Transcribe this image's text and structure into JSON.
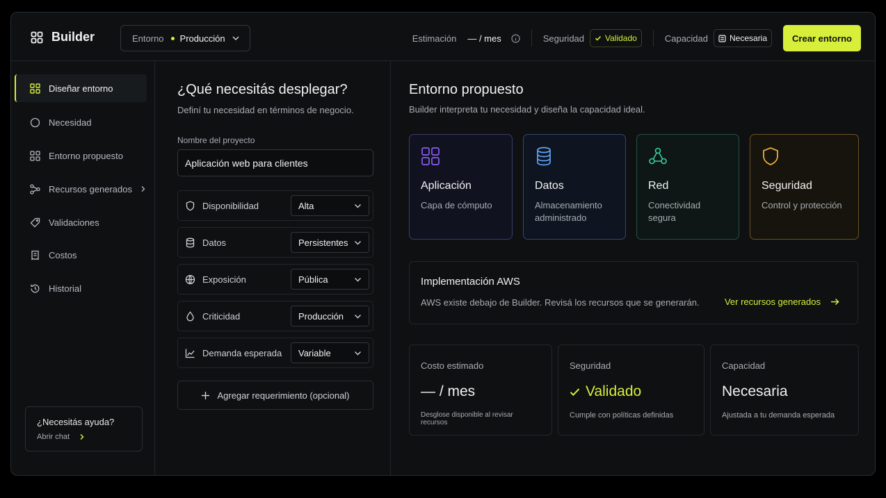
{
  "app": {
    "title": "Builder"
  },
  "header": {
    "env_label": "Entorno",
    "env_value": "Producción",
    "estimate_label": "Estimación",
    "estimate_value": "— / mes",
    "security_label": "Seguridad",
    "security_value": "Validado",
    "capacity_label": "Capacidad",
    "capacity_value": "Necesaria",
    "create_button": "Crear entorno"
  },
  "sidebar": {
    "items": [
      {
        "label": "Diseñar entorno",
        "icon": "grid-icon",
        "active": true
      },
      {
        "label": "Necesidad",
        "icon": "circle-icon"
      },
      {
        "label": "Entorno propuesto",
        "icon": "grid-icon"
      },
      {
        "label": "Recursos generados",
        "icon": "nodes-icon"
      },
      {
        "label": "Validaciones",
        "icon": "tag-icon"
      },
      {
        "label": "Costos",
        "icon": "receipt-icon"
      },
      {
        "label": "Historial",
        "icon": "history-icon"
      }
    ],
    "help_title": "¿Necesitás ayuda?",
    "help_link": "Abrir chat"
  },
  "form": {
    "title": "¿Qué necesitás desplegar?",
    "subtitle": "Definí tu necesidad en términos de negocio.",
    "project_label": "Nombre del proyecto",
    "project_value": "Aplicación web para clientes",
    "requirements": [
      {
        "name": "Disponibilidad",
        "value": "Alta",
        "icon": "shield-icon"
      },
      {
        "name": "Datos",
        "value": "Persistentes",
        "icon": "database-icon"
      },
      {
        "name": "Exposición",
        "value": "Pública",
        "icon": "globe-icon"
      },
      {
        "name": "Criticidad",
        "value": "Producción",
        "icon": "drop-icon"
      },
      {
        "name": "Demanda esperada",
        "value": "Variable",
        "icon": "chart-icon"
      }
    ],
    "add_requirement": "Agregar requerimiento (opcional)"
  },
  "proposal": {
    "title": "Entorno propuesto",
    "subtitle": "Builder interpreta tu necesidad y diseña la capacidad ideal.",
    "cards": [
      {
        "title": "Aplicación",
        "desc": "Capa de cómputo",
        "color": "#8b5cf6"
      },
      {
        "title": "Datos",
        "desc": "Almacenamiento administrado",
        "color": "#60a5fa"
      },
      {
        "title": "Red",
        "desc": "Conectividad segura",
        "color": "#34d399"
      },
      {
        "title": "Seguridad",
        "desc": "Control y protección",
        "color": "#f5b93c"
      }
    ],
    "aws": {
      "title": "Implementación AWS",
      "desc": "AWS existe debajo de Builder. Revisá los recursos que se generarán.",
      "link": "Ver recursos generados"
    },
    "stats": [
      {
        "title": "Costo estimado",
        "value": "— / mes",
        "note": "Desglose disponible al revisar recursos"
      },
      {
        "title": "Seguridad",
        "value": "Validado",
        "note": "Cumple con políticas definidas"
      },
      {
        "title": "Capacidad",
        "value": "Necesaria",
        "note": "Ajustada a tu demanda esperada"
      }
    ]
  },
  "colors": {
    "accent": "#d7ef3b",
    "background": "#0e1012"
  }
}
